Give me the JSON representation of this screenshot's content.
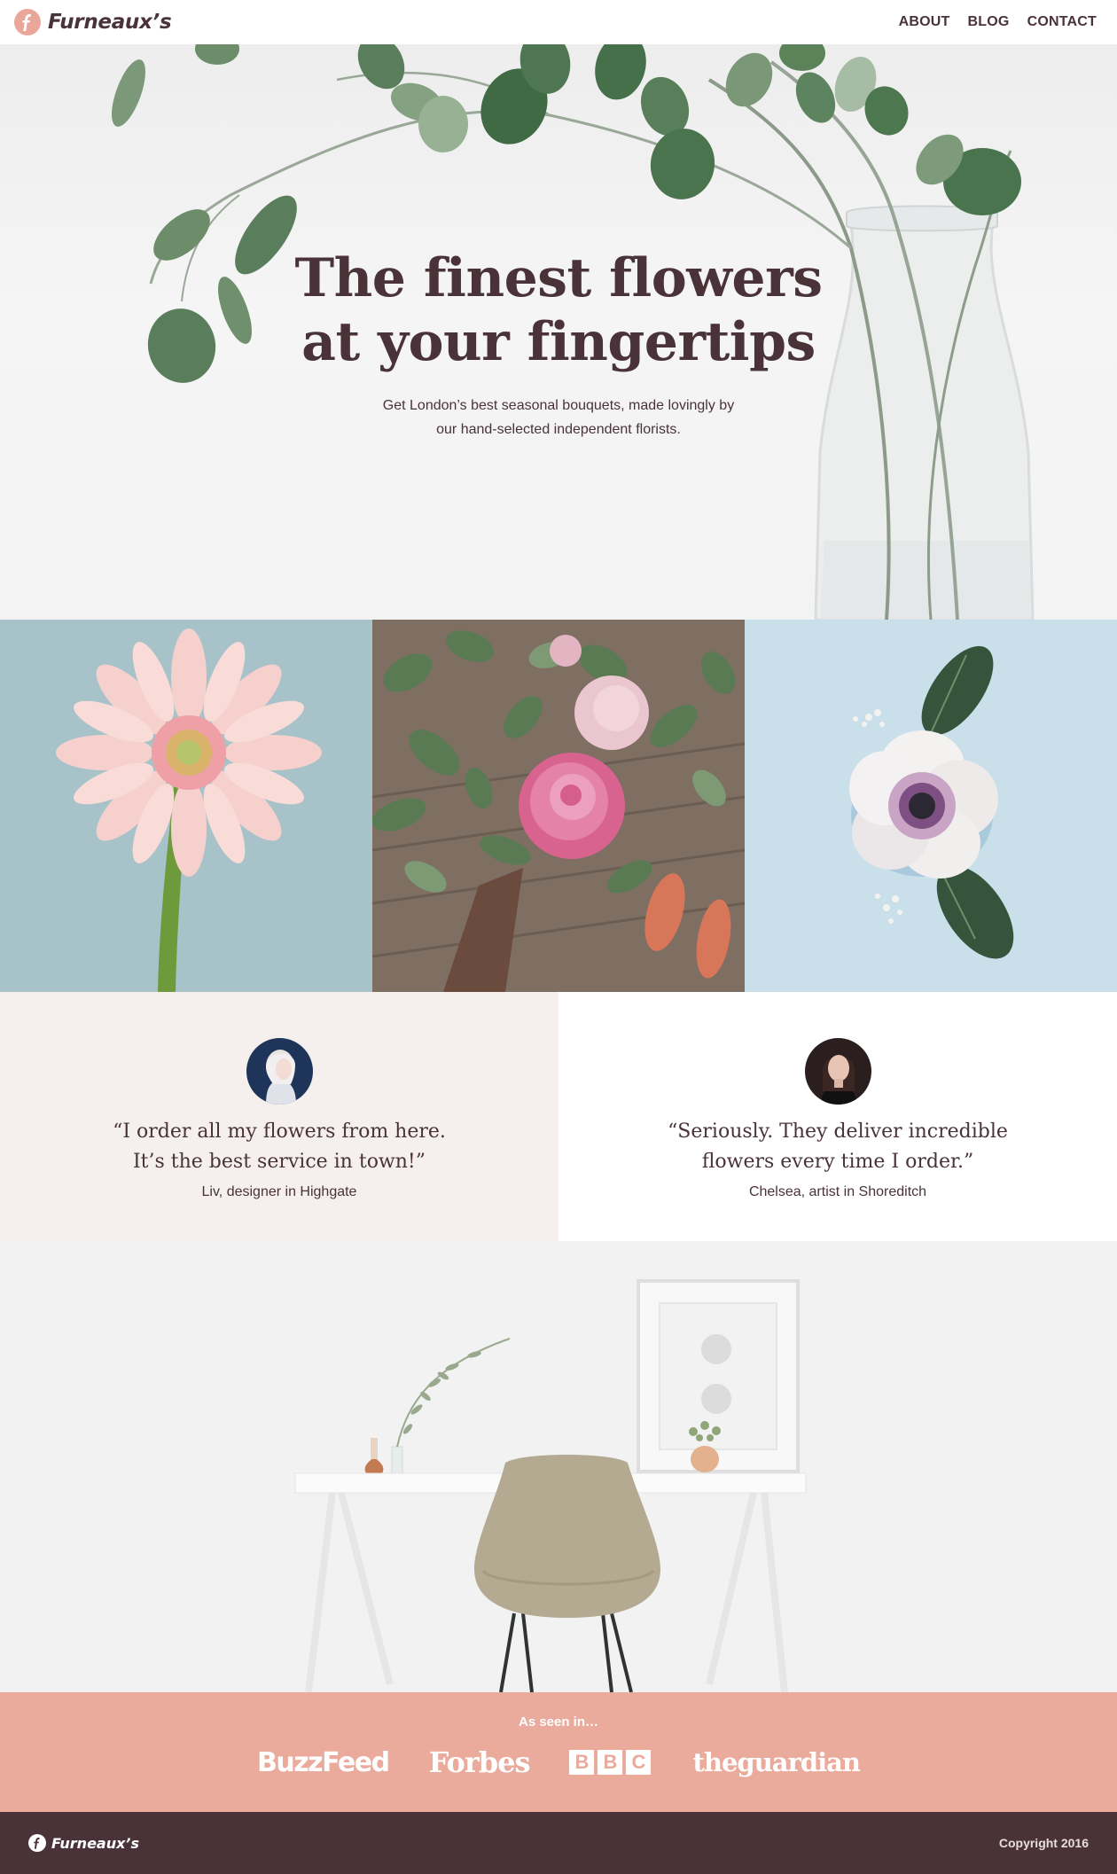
{
  "nav": {
    "brand": "Furneaux’s",
    "links": [
      "ABOUT",
      "BLOG",
      "CONTACT"
    ]
  },
  "hero": {
    "title_line1": "The finest flowers",
    "title_line2": "at your fingertips",
    "subtitle_line1": "Get London’s best seasonal bouquets, made lovingly by",
    "subtitle_line2": "our hand-selected independent florists.",
    "image": "eucalyptus-vase-photo"
  },
  "gallery": {
    "images": [
      "pink-gerbera-photo",
      "peony-bouquet-photo",
      "white-anemone-photo"
    ]
  },
  "testimonials": [
    {
      "quote_line1": "“I order all my flowers from here.",
      "quote_line2": "It’s the best service in town!”",
      "author": "Liv, designer in Highgate",
      "avatar": "liv-avatar"
    },
    {
      "quote_line1": "“Seriously. They deliver incredible",
      "quote_line2": "flowers every time I order.”",
      "author": "Chelsea, artist in Shoreditch",
      "avatar": "chelsea-avatar"
    }
  ],
  "feature_image": "desk-and-chair-photo",
  "press": {
    "label": "As seen in…",
    "logos": [
      "BuzzFeed",
      "Forbes",
      "BBC",
      "theguardian"
    ],
    "bbc_letters": [
      "B",
      "B",
      "C"
    ]
  },
  "footer": {
    "brand": "Furneaux’s",
    "copyright": "Copyright 2016"
  },
  "colors": {
    "brand_dark": "#4a3338",
    "accent_pink": "#eaaa9c",
    "testimonial_bg": "#f5f0ed"
  }
}
